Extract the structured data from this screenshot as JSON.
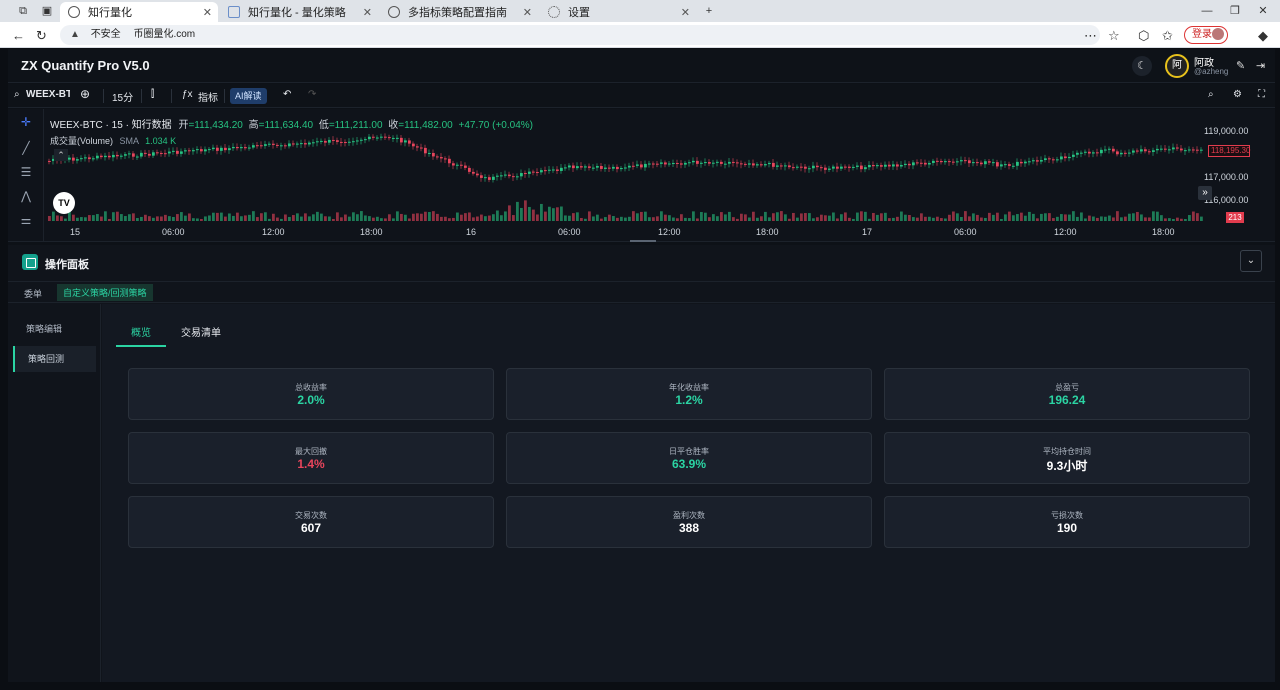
{
  "browser": {
    "tabs": [
      {
        "label": "知行量化",
        "active": true
      },
      {
        "label": "知行量化 - 量化策略",
        "active": false
      },
      {
        "label": "多指标策略配置指南",
        "active": false
      },
      {
        "label": "设置",
        "active": false
      }
    ],
    "security_label": "不安全",
    "url": "币圈量化.com",
    "login_label": "登录"
  },
  "app": {
    "title": "ZX Quantify Pro V5.0",
    "user_avatar": "阿",
    "user_name": "阿政",
    "user_handle": "@azheng"
  },
  "toolbar": {
    "symbol": "WEEX-BTC",
    "interval": "15分",
    "indicators_label": "指标",
    "ai_label": "AI解读"
  },
  "chart": {
    "legend_title": "WEEX-BTC · 15 · 知行数据",
    "open_label": "开",
    "open_value": "=111,434.20",
    "high_label": "高",
    "high_value": "=111,634.40",
    "low_label": "低",
    "low_value": "=111,211.00",
    "close_label": "收",
    "close_value": "=111,482.00",
    "change_value": "+47.70 (+0.04%)",
    "volume_label": "成交量(Volume)",
    "sma_label": "SMA",
    "volume_value": "1.034 K",
    "price_ticks": [
      "119,000.00",
      "117,000.00",
      "116,000.00"
    ],
    "current_price": "118,195.30",
    "volume_tag": "213",
    "time_ticks": [
      "15",
      "06:00",
      "12:00",
      "18:00",
      "16",
      "06:00",
      "12:00",
      "18:00",
      "17",
      "06:00",
      "12:00",
      "18:00"
    ],
    "tv_logo": "TV"
  },
  "panel": {
    "title": "操作面板",
    "tabs": [
      "委单",
      "自定义策略/回测策略"
    ],
    "side_items": [
      "策略编辑",
      "策略回测"
    ],
    "content_tabs": [
      "概览",
      "交易清单"
    ],
    "cards": [
      {
        "label": "总收益率",
        "value": "2.0%",
        "tone": "green"
      },
      {
        "label": "年化收益率",
        "value": "1.2%",
        "tone": "green"
      },
      {
        "label": "总盈亏",
        "value": "196.24",
        "tone": "green"
      },
      {
        "label": "最大回撤",
        "value": "1.4%",
        "tone": "red"
      },
      {
        "label": "日平仓胜率",
        "value": "63.9%",
        "tone": "green"
      },
      {
        "label": "平均持仓时间",
        "value": "9.3小时",
        "tone": "white"
      },
      {
        "label": "交易次数",
        "value": "607",
        "tone": "white"
      },
      {
        "label": "盈利次数",
        "value": "388",
        "tone": "white"
      },
      {
        "label": "亏损次数",
        "value": "190",
        "tone": "white"
      }
    ]
  },
  "colors": {
    "accent": "#2bd4a3",
    "down": "#e8455c",
    "up": "#26c281"
  }
}
